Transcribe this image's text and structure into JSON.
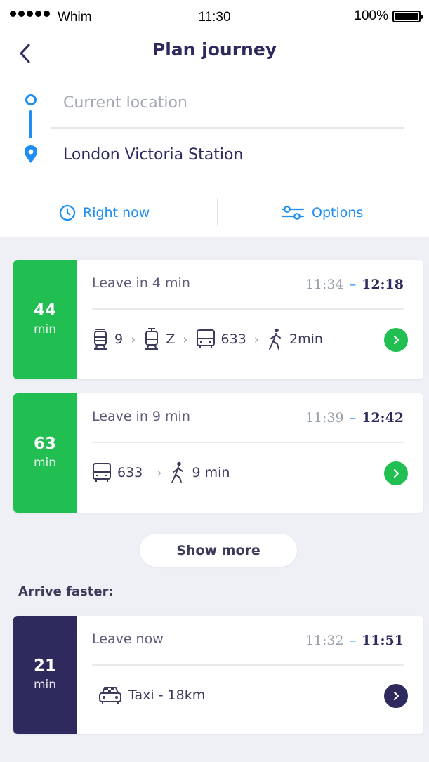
{
  "status_bar": {
    "carrier": "Whim",
    "time": "11:30",
    "battery": "100%"
  },
  "header": {
    "title": "Plan journey",
    "back_icon": "chevron-left-icon"
  },
  "route": {
    "origin_placeholder": "Current location",
    "destination": "London Victoria Station"
  },
  "options_bar": {
    "time_label": "Right now",
    "options_label": "Options"
  },
  "colors": {
    "accent": "#1e8ef3",
    "green": "#21bf52",
    "navy": "#2e2a5e",
    "background": "#eef0f6"
  },
  "journeys": [
    {
      "duration": "44",
      "unit": "min",
      "leave": "Leave in 4 min",
      "depart": "11:34",
      "dash": "–",
      "arrive": "12:18",
      "legs": [
        {
          "icon": "train-icon",
          "label": "9"
        },
        {
          "icon": "tram-icon",
          "label": "Z"
        },
        {
          "icon": "bus-icon",
          "label": "633"
        },
        {
          "icon": "walk-icon",
          "label": "2min"
        }
      ]
    },
    {
      "duration": "63",
      "unit": "min",
      "leave": "Leave in 9 min",
      "depart": "11:39",
      "dash": "–",
      "arrive": "12:42",
      "legs": [
        {
          "icon": "bus-icon",
          "label": "633"
        },
        {
          "icon": "walk-icon",
          "label": "9 min"
        }
      ]
    }
  ],
  "show_more": "Show more",
  "arrive_faster": {
    "heading": "Arrive faster:",
    "option": {
      "duration": "21",
      "unit": "min",
      "leave": "Leave now",
      "depart": "11:32",
      "dash": "–",
      "arrive": "11:51",
      "legs": [
        {
          "icon": "taxi-icon",
          "label": "Taxi - 18km"
        }
      ]
    }
  }
}
